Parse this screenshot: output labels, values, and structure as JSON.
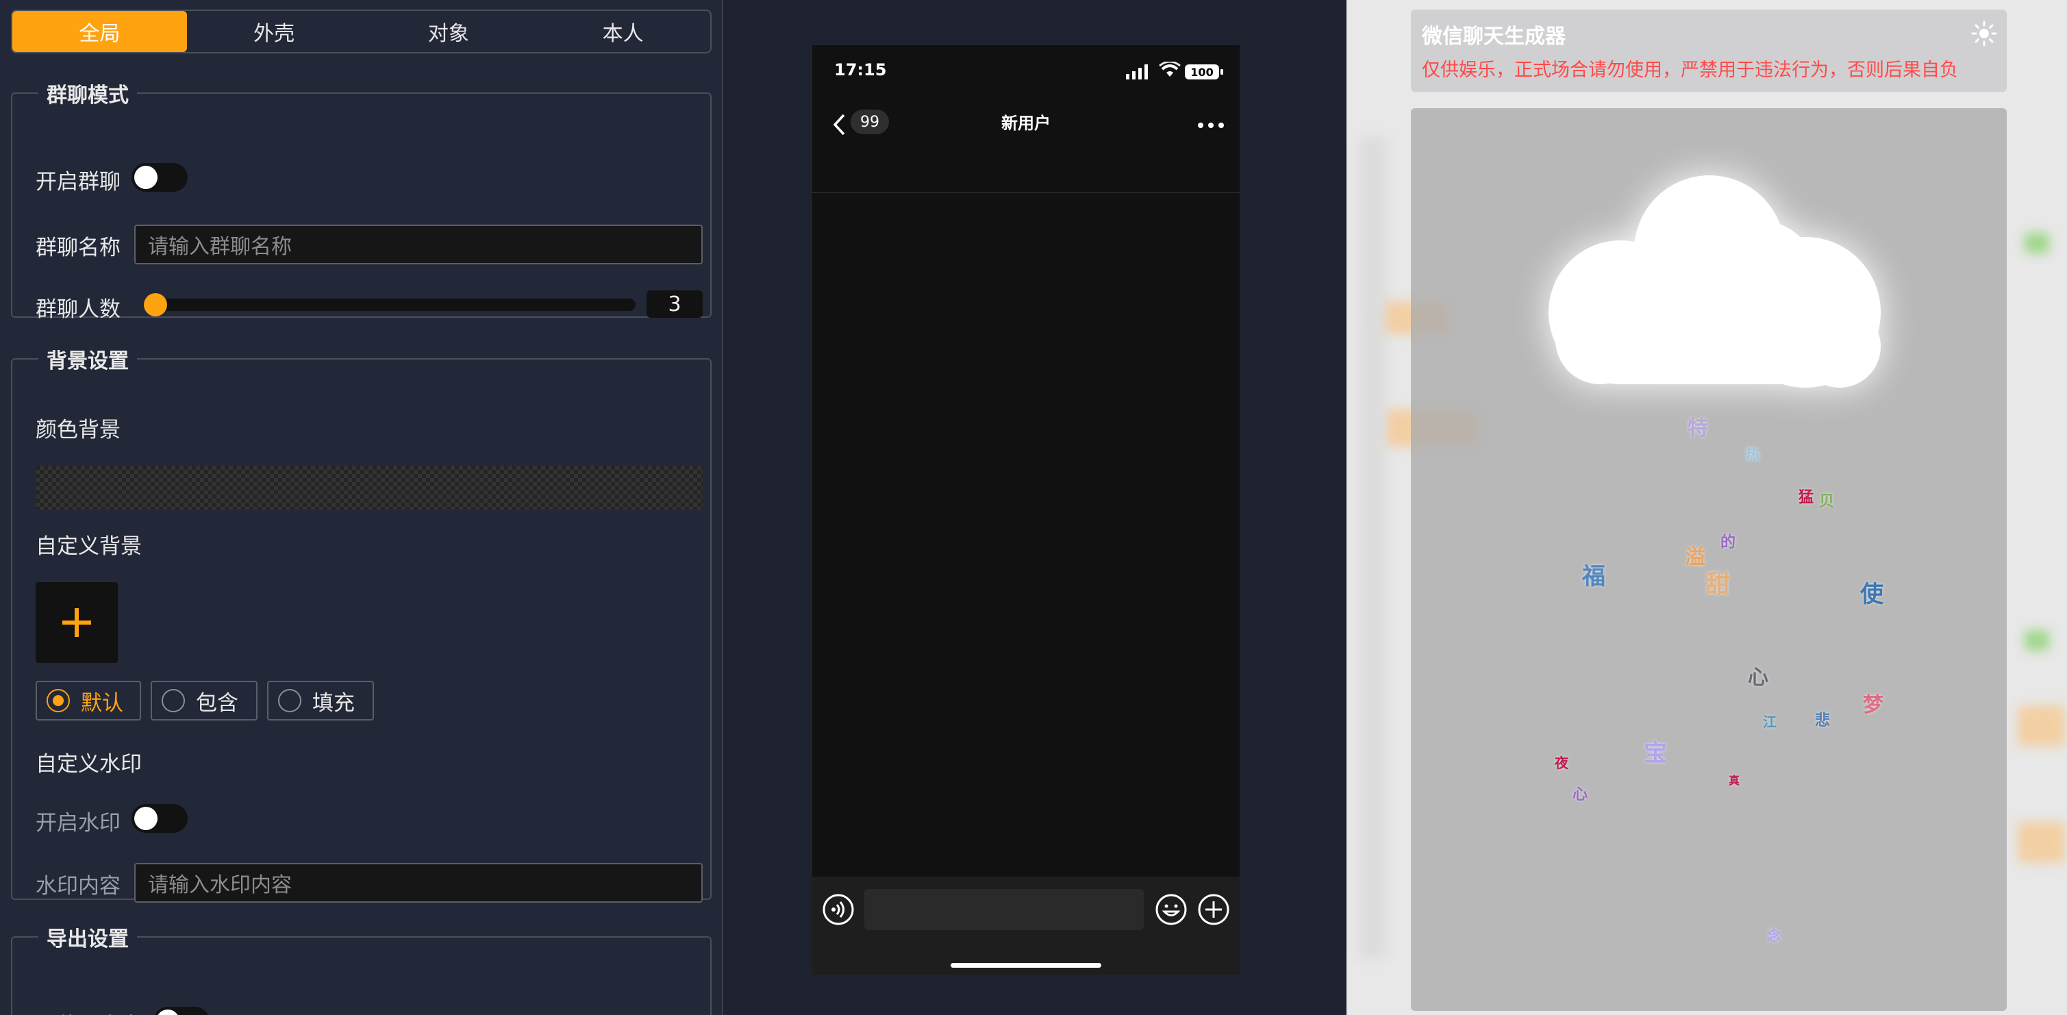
{
  "tabs": [
    "全局",
    "外壳",
    "对象",
    "本人"
  ],
  "group_chat": {
    "legend": "群聊模式",
    "enable_label": "开启群聊",
    "name_label": "群聊名称",
    "name_placeholder": "请输入群聊名称",
    "count_label": "群聊人数",
    "count_value": "3"
  },
  "background": {
    "legend": "背景设置",
    "color_label": "颜色背景",
    "custom_label": "自定义背景",
    "fit_options": [
      "默认",
      "包含",
      "填充"
    ],
    "fit_selected": "默认",
    "watermark_label": "自定义水印",
    "watermark_enable_label": "开启水印",
    "watermark_content_label": "水印内容",
    "watermark_placeholder": "请输入水印内容"
  },
  "export": {
    "legend": "导出设置",
    "crop_label": "仅截取内容"
  },
  "phone": {
    "time": "17:15",
    "battery": "100",
    "back_badge": "99",
    "title": "新用户"
  },
  "right": {
    "title": "微信聊天生成器",
    "warning": "仅供娱乐，正式场合请勿使用，严禁用于违法行为，否则后果自负",
    "chars": [
      "特",
      "热",
      "猛",
      "贝",
      "的",
      "溢",
      "福",
      "甜",
      "使",
      "心",
      "江",
      "悲",
      "梦",
      "宝",
      "夜",
      "真",
      "心",
      "念"
    ]
  },
  "colors": {
    "accent": "#ffa311",
    "panel_bg": "#232838",
    "warning": "#ff4a4a"
  }
}
